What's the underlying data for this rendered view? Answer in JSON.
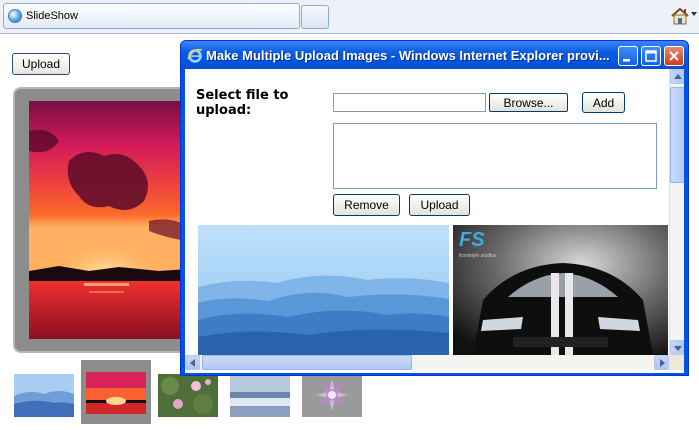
{
  "browser": {
    "tab_title": "SlideShow",
    "home_icon": "home-icon",
    "accent_color": "#0054e3"
  },
  "page": {
    "upload_label": "Upload"
  },
  "slideshow": {
    "main_image": "sunset-over-lake-image",
    "thumbnails": [
      {
        "image": "blue-mountains-thumbnail",
        "selected": false
      },
      {
        "image": "sunset-thumbnail",
        "selected": true
      },
      {
        "image": "water-lilies-thumbnail",
        "selected": false
      },
      {
        "image": "winter-trees-thumbnail",
        "selected": false
      },
      {
        "image": "purple-flower-thumbnail",
        "selected": false
      }
    ]
  },
  "popup": {
    "title": "Make Multiple Upload Images - Windows Internet Explorer provi...",
    "select_label": "Select file to upload:",
    "file_input_value": "",
    "browse_label": "Browse...",
    "add_label": "Add",
    "remove_label": "Remove",
    "upload_label": "Upload",
    "gallery": [
      {
        "image": "blue-mountains-image"
      },
      {
        "image": "black-sports-car-image",
        "logo_text": "FS",
        "logo_caption": "frontstyle studios"
      }
    ]
  }
}
